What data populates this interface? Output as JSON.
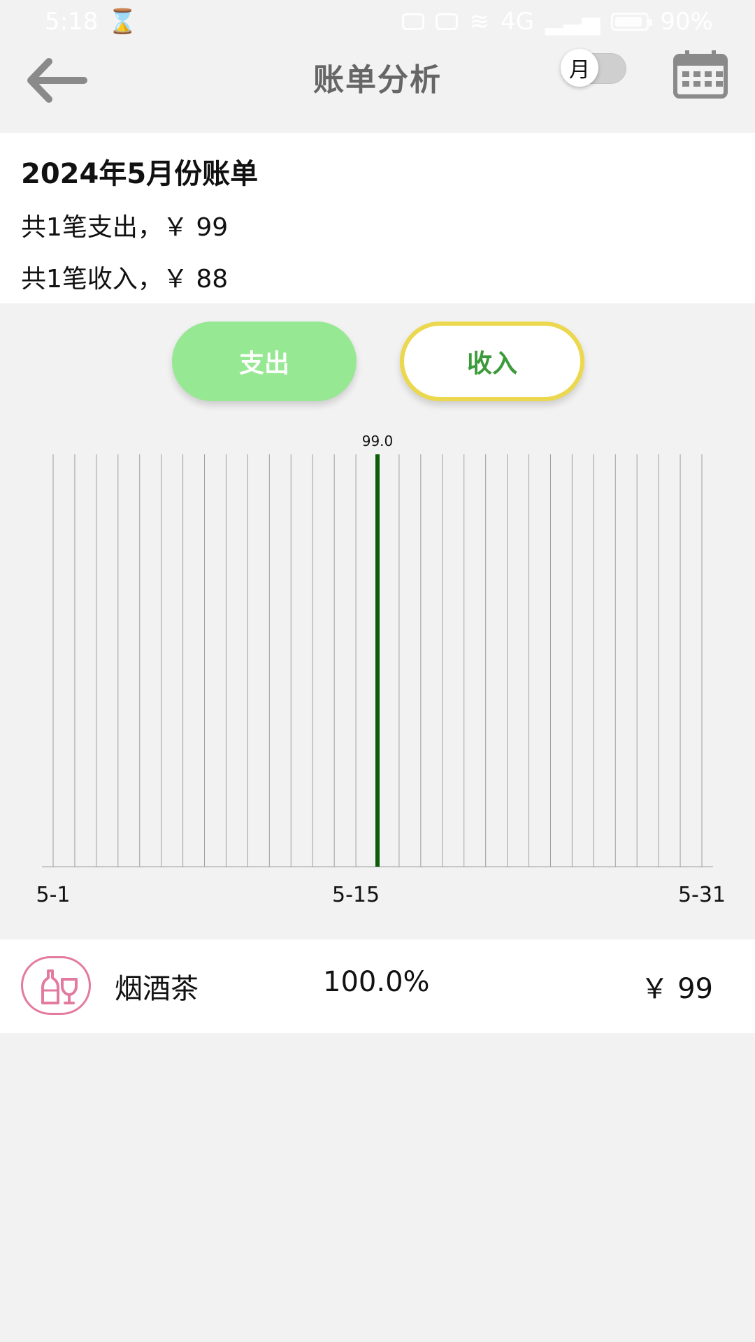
{
  "status_bar": {
    "time": "5:18",
    "network": "4G",
    "battery": "90%",
    "battery_level": 0.9
  },
  "header": {
    "title": "账单分析",
    "toggle_label": "月"
  },
  "summary": {
    "month_title": "2024年5月份账单",
    "expense_line": "共1笔支出，￥ 99",
    "income_line": "共1笔收入，￥ 88"
  },
  "tabs": {
    "expense": "支出",
    "income": "收入",
    "selected": "income"
  },
  "chart_data": {
    "type": "bar",
    "x": [
      1,
      2,
      3,
      4,
      5,
      6,
      7,
      8,
      9,
      10,
      11,
      12,
      13,
      14,
      15,
      16,
      17,
      18,
      19,
      20,
      21,
      22,
      23,
      24,
      25,
      26,
      27,
      28,
      29,
      30,
      31
    ],
    "values": [
      0,
      0,
      0,
      0,
      0,
      0,
      0,
      0,
      0,
      0,
      0,
      0,
      0,
      0,
      0,
      99.0,
      0,
      0,
      0,
      0,
      0,
      0,
      0,
      0,
      0,
      0,
      0,
      0,
      0,
      0,
      0
    ],
    "x_ticks": [
      "5-1",
      "5-15",
      "5-31"
    ],
    "ylim": [
      0,
      99.0
    ],
    "data_label": "99.0",
    "bar_color": "#0b5d0b",
    "grid_color": "#9e9e9e"
  },
  "categories": [
    {
      "name": "烟酒茶",
      "percent": "100.0%",
      "amount": "￥ 99",
      "icon": "wine-bottle-icon",
      "icon_color": "#e37aa0"
    }
  ]
}
